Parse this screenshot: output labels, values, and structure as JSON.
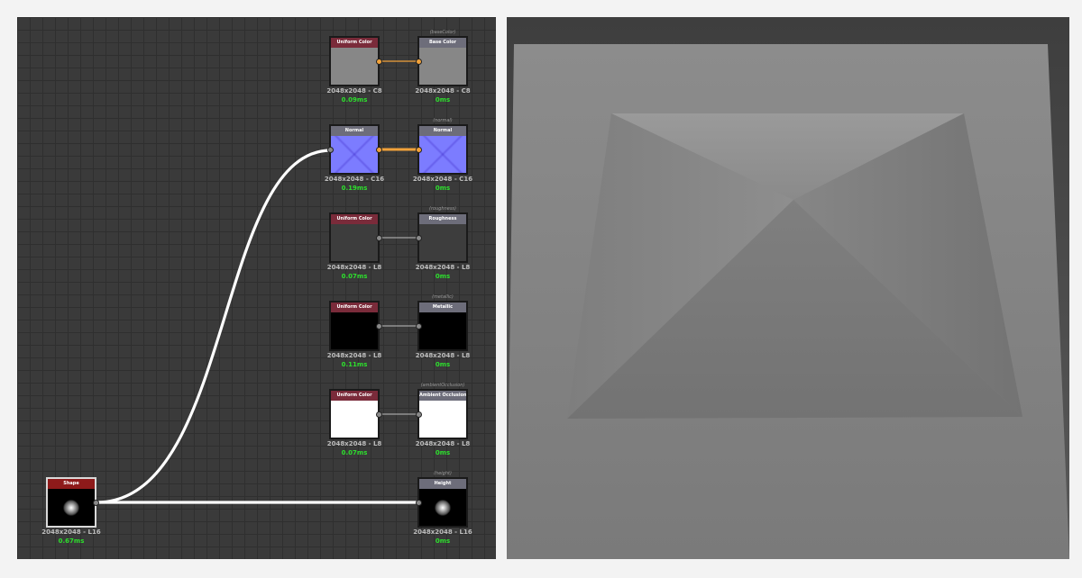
{
  "graph": {
    "nodes": [
      {
        "title": "Uniform Color",
        "res": "2048x2048 - C8",
        "time": "0.09ms"
      },
      {
        "title": "Base Color",
        "id": "(baseColor)",
        "res": "2048x2048 - C8",
        "time": "0ms"
      },
      {
        "title": "Normal",
        "res": "2048x2048 - C16",
        "time": "0.19ms"
      },
      {
        "title": "Normal",
        "id": "(normal)",
        "res": "2048x2048 - C16",
        "time": "0ms"
      },
      {
        "title": "Uniform Color",
        "res": "2048x2048 - L8",
        "time": "0.07ms"
      },
      {
        "title": "Roughness",
        "id": "(roughness)",
        "res": "2048x2048 - L8",
        "time": "0ms"
      },
      {
        "title": "Uniform Color",
        "res": "2048x2048 - L8",
        "time": "0.11ms"
      },
      {
        "title": "Metallic",
        "id": "(metallic)",
        "res": "2048x2048 - L8",
        "time": "0ms"
      },
      {
        "title": "Uniform Color",
        "res": "2048x2048 - L8",
        "time": "0.07ms"
      },
      {
        "title": "Ambient Occlusion",
        "id": "(ambientOcclusion)",
        "res": "2048x2048 - L8",
        "time": "0ms"
      },
      {
        "title": "Shape",
        "res": "2048x2048 - L16",
        "time": "0.67ms"
      },
      {
        "title": "Height",
        "id": "(height)",
        "res": "2048x2048 - L16",
        "time": "0ms"
      }
    ]
  },
  "colors": {
    "graph_bg": "#3a3a3a",
    "header_uniform": "#7a2b3a",
    "header_output": "#6d6d7a",
    "header_shape": "#8e1a1a",
    "time_green": "#2ddf2d",
    "port_orange": "#f2a23a",
    "normal_blue": "#7c7cff"
  }
}
